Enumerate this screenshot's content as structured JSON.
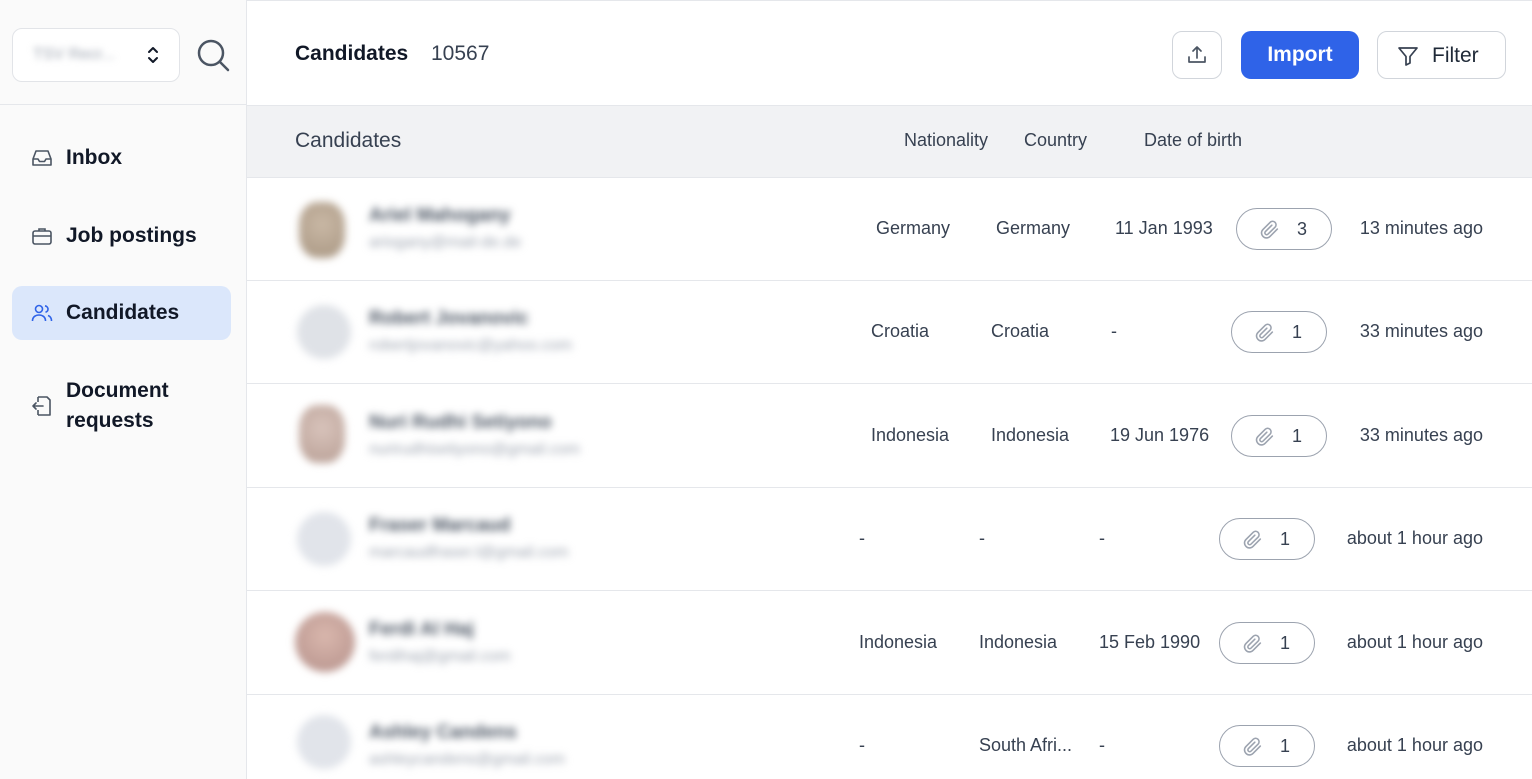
{
  "sidebar": {
    "org_selector": {
      "label": "TSV Recr..."
    },
    "items": [
      {
        "label": "Inbox",
        "icon": "inbox-icon"
      },
      {
        "label": "Job postings",
        "icon": "briefcase-icon"
      },
      {
        "label": "Candidates",
        "icon": "users-icon",
        "active": true
      },
      {
        "label": "Document requests",
        "icon": "document-request-icon"
      }
    ]
  },
  "header": {
    "title": "Candidates",
    "count": "10567",
    "import_label": "Import",
    "filter_label": "Filter"
  },
  "table": {
    "columns": {
      "candidates": "Candidates",
      "nationality": "Nationality",
      "country": "Country",
      "date_of_birth": "Date of birth"
    },
    "rows": [
      {
        "name": "Ariel Mahogany",
        "email": "ariogany@mail-de.de",
        "nationality": "Germany",
        "country": "Germany",
        "dob": "11 Jan 1993",
        "attachments": "3",
        "updated": "13 minutes ago"
      },
      {
        "name": "Robert Jovanovic",
        "email": "robertjovanovic@yahoo.com",
        "nationality": "Croatia",
        "country": "Croatia",
        "dob": "-",
        "attachments": "1",
        "updated": "33 minutes ago"
      },
      {
        "name": "Nuri Rudhi Setiyono",
        "email": "nurirudhisetiyono@gmail.com",
        "nationality": "Indonesia",
        "country": "Indonesia",
        "dob": "19 Jun 1976",
        "attachments": "1",
        "updated": "33 minutes ago"
      },
      {
        "name": "Fraser Marcaud",
        "email": "marcaudfraser.l@gmail.com",
        "nationality": "-",
        "country": "-",
        "dob": "-",
        "attachments": "1",
        "updated": "about 1 hour ago"
      },
      {
        "name": "Ferdi Al Haj",
        "email": "ferdihaj@gmail.com",
        "nationality": "Indonesia",
        "country": "Indonesia",
        "dob": "15 Feb 1990",
        "attachments": "1",
        "updated": "about 1 hour ago"
      },
      {
        "name": "Ashley Candens",
        "email": "ashleycandens@gmail.com",
        "nationality": "-",
        "country": "South Afri...",
        "dob": "-",
        "attachments": "1",
        "updated": "about 1 hour ago"
      }
    ]
  },
  "colors": {
    "accent": "#2f63e8",
    "active_nav_bg": "#dbe7fb",
    "table_header_bg": "#f1f2f4"
  }
}
